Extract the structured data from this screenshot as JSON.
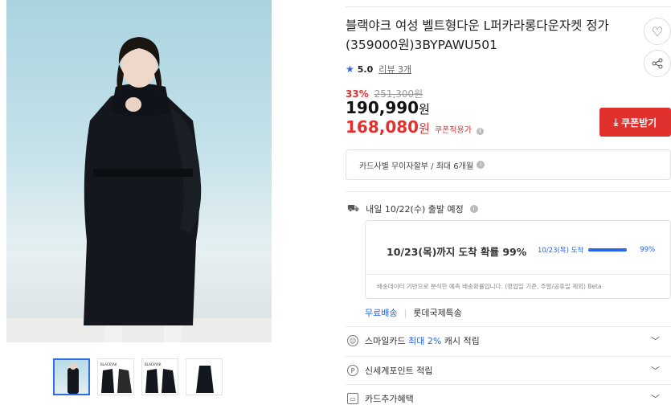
{
  "product": {
    "title": "블랙야크 여성 벨트형다운 L퍼카라롱다운자켓 정가(359000원)3BYPAWU501",
    "rating": "5.0",
    "review_link": "리뷰 3개",
    "discount_rate": "33%",
    "original_price": "251,300원",
    "price": "190,990",
    "price_unit": "원",
    "coupon_price": "168,080",
    "coupon_price_unit": "원",
    "coupon_tag": "쿠폰적용가",
    "coupon_button": "쿠폰받기"
  },
  "payment": {
    "card_installment": "카드사별 무이자할부 / 최대 6개월"
  },
  "shipping": {
    "dispatch": "내일 10/22(수) 출발 예정",
    "probability_title": "10/23(목)까지 도착 확률 99%",
    "probability_date": "10/23(목) 도착",
    "probability_pct": "99%",
    "probability_value": 0.99,
    "probability_note": "배송데이터 기반으로 분석한 예측 배송확률입니다. (영업일 기준, 주말/공휴일 제외) Beta",
    "free_shipping": "무료배송",
    "method_separator": "|",
    "carrier": "롯데국제특송"
  },
  "benefits": [
    {
      "icon": "smile-card-icon",
      "glyph": "☺",
      "prefix": "스마일카드 ",
      "highlight": "최대 2%",
      "suffix": " 캐시 적립"
    },
    {
      "icon": "points-icon",
      "glyph": "P",
      "prefix": "신세계포인트 적립",
      "highlight": "",
      "suffix": ""
    },
    {
      "icon": "card-benefit-icon",
      "glyph": "▭",
      "prefix": "카드추가혜택",
      "highlight": "",
      "suffix": ""
    }
  ],
  "icons": {
    "heart": "heart-icon",
    "share": "share-icon",
    "info": "info-icon",
    "download": "download-icon",
    "truck": "truck-icon",
    "chevron": "chevron-down-icon",
    "star": "star-icon"
  },
  "colors": {
    "accent": "#2b64e8",
    "sale": "#e0312f"
  }
}
